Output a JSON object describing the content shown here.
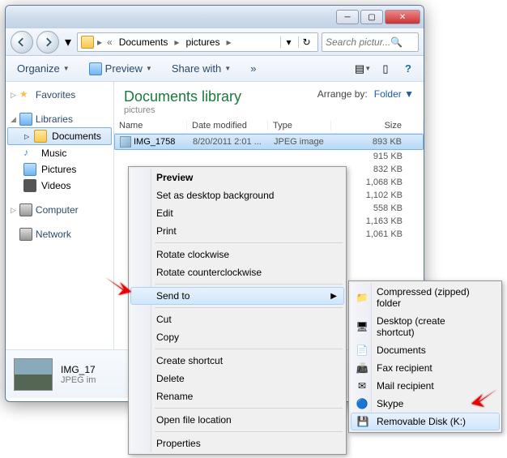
{
  "titlebar": {
    "min": "─",
    "max": "▢",
    "close": "✕"
  },
  "breadcrumb": {
    "items": [
      "Documents",
      "pictures"
    ],
    "search_placeholder": "Search pictur..."
  },
  "toolbar": {
    "organize": "Organize",
    "preview": "Preview",
    "share": "Share with",
    "chevrons": "»"
  },
  "sidebar": {
    "favorites": "Favorites",
    "libraries": "Libraries",
    "lib_items": [
      "Documents",
      "Music",
      "Pictures",
      "Videos"
    ],
    "computer": "Computer",
    "network": "Network"
  },
  "library": {
    "title": "Documents library",
    "subtitle": "pictures",
    "arrange_label": "Arrange by:",
    "arrange_value": "Folder"
  },
  "columns": {
    "name": "Name",
    "date": "Date modified",
    "type": "Type",
    "size": "Size"
  },
  "files": [
    {
      "name": "IMG_1758",
      "date": "8/20/2011 2:01 ...",
      "type": "JPEG image",
      "size": "893 KB"
    },
    {
      "name": "",
      "date": "",
      "type": "",
      "size": "915 KB"
    },
    {
      "name": "",
      "date": "",
      "type": "",
      "size": "832 KB"
    },
    {
      "name": "",
      "date": "",
      "type": "",
      "size": "1,068 KB"
    },
    {
      "name": "",
      "date": "",
      "type": "",
      "size": "1,102 KB"
    },
    {
      "name": "",
      "date": "",
      "type": "",
      "size": "558 KB"
    },
    {
      "name": "",
      "date": "",
      "type": "",
      "size": "1,163 KB"
    },
    {
      "name": "",
      "date": "",
      "type": "",
      "size": "1,061 KB"
    }
  ],
  "details": {
    "name": "IMG_17",
    "type": "JPEG im"
  },
  "context_menu": {
    "items": [
      {
        "label": "Preview",
        "bold": true
      },
      {
        "label": "Set as desktop background"
      },
      {
        "label": "Edit"
      },
      {
        "label": "Print"
      },
      {
        "sep": true
      },
      {
        "label": "Rotate clockwise"
      },
      {
        "label": "Rotate counterclockwise"
      },
      {
        "sep": true
      },
      {
        "label": "Send to",
        "submenu": true,
        "highlighted": true
      },
      {
        "sep": true
      },
      {
        "label": "Cut"
      },
      {
        "label": "Copy"
      },
      {
        "sep": true
      },
      {
        "label": "Create shortcut"
      },
      {
        "label": "Delete"
      },
      {
        "label": "Rename"
      },
      {
        "sep": true
      },
      {
        "label": "Open file location"
      },
      {
        "sep": true
      },
      {
        "label": "Properties"
      }
    ],
    "submenu": [
      {
        "label": "Compressed (zipped) folder",
        "icon": "zip"
      },
      {
        "label": "Desktop (create shortcut)",
        "icon": "desktop"
      },
      {
        "label": "Documents",
        "icon": "docs"
      },
      {
        "label": "Fax recipient",
        "icon": "fax"
      },
      {
        "label": "Mail recipient",
        "icon": "mail"
      },
      {
        "label": "Skype",
        "icon": "skype"
      },
      {
        "label": "Removable Disk (K:)",
        "icon": "drive",
        "highlighted": true
      }
    ]
  }
}
